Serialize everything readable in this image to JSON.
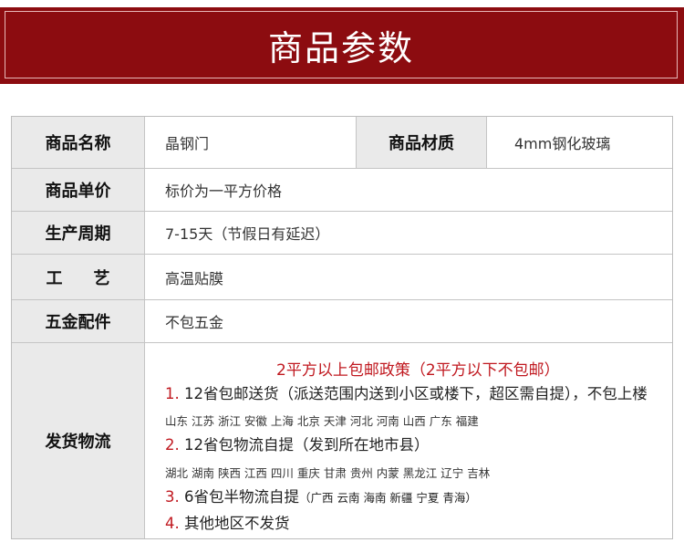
{
  "banner": {
    "title": "商品参数"
  },
  "rows": {
    "name": {
      "label": "商品名称",
      "value": "晶钢门",
      "label2": "商品材质",
      "value2": "4mm钢化玻璃"
    },
    "price": {
      "label": "商品单价",
      "value": "标价为一平方价格"
    },
    "period": {
      "label": "生产周期",
      "value": "7-15天（节假日有延迟）"
    },
    "craft": {
      "label": "工艺",
      "value": "高温贴膜"
    },
    "hardware": {
      "label": "五金配件",
      "value": "不包五金"
    },
    "shipping": {
      "label": "发货物流",
      "policy": "2平方以上包邮政策（2平方以下不包邮）",
      "item1_num": "1.",
      "item1_text": " 12省包邮送货（派送范围内送到小区或楼下，超区需自提），不包上楼",
      "item1_provinces": "山东 江苏 浙江 安徽 上海 北京 天津 河北 河南 山西  广东 福建",
      "item2_num": "2.",
      "item2_text": " 12省包物流自提（发到所在地市县）",
      "item2_provinces": "湖北 湖南  陕西 江西 四川 重庆 甘肃 贵州  内蒙  黑龙江 辽宁 吉林",
      "item3_num": "3.",
      "item3_text": " 6省包半物流自提",
      "item3_note": "（广西 云南 海南 新疆 宁夏 青海）",
      "item4_num": "4.",
      "item4_text": " 其他地区不发货"
    }
  }
}
